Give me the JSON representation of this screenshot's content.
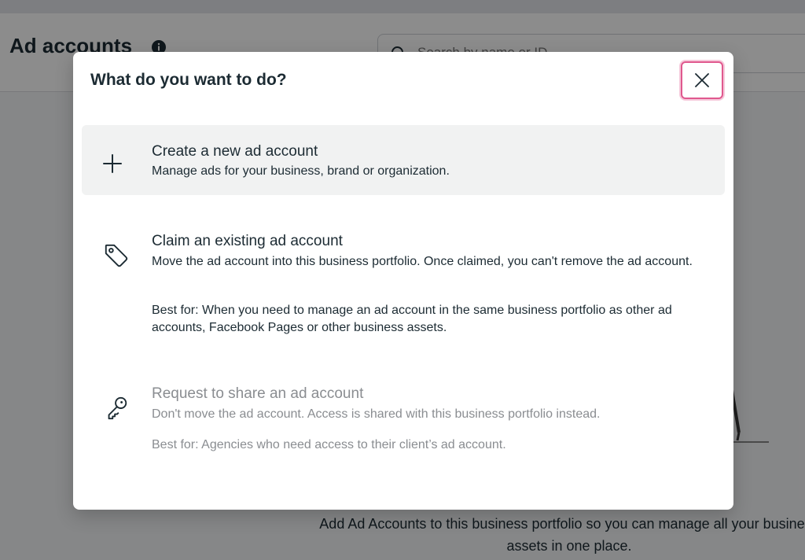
{
  "background": {
    "page_title": "Ad accounts",
    "search": {
      "placeholder": "Search by name or ID",
      "value": ""
    },
    "empty_state_text": "Add Ad Accounts to this business portfolio so you can manage all your business assets in one place."
  },
  "modal": {
    "title": "What do you want to do?",
    "options": [
      {
        "icon": "plus-icon",
        "title": "Create a new ad account",
        "description": "Manage ads for your business, brand or organization.",
        "best_for": ""
      },
      {
        "icon": "tag-icon",
        "title": "Claim an existing ad account",
        "description": "Move the ad account into this business portfolio. Once claimed, you can't remove the ad account.",
        "best_for": "Best for: When you need to manage an ad account in the same business portfolio as other ad accounts, Facebook Pages or other business assets."
      },
      {
        "icon": "key-icon",
        "title": "Request to share an ad account",
        "description": "Don't move the ad account. Access is shared with this business portfolio instead.",
        "best_for": "Best for: Agencies who need access to their client’s ad account."
      }
    ]
  },
  "colors": {
    "text": "#1c2b33",
    "muted_text": "#8a8d91",
    "highlight_bg": "#f1f2f2",
    "focus_ring": "#e0588e"
  }
}
